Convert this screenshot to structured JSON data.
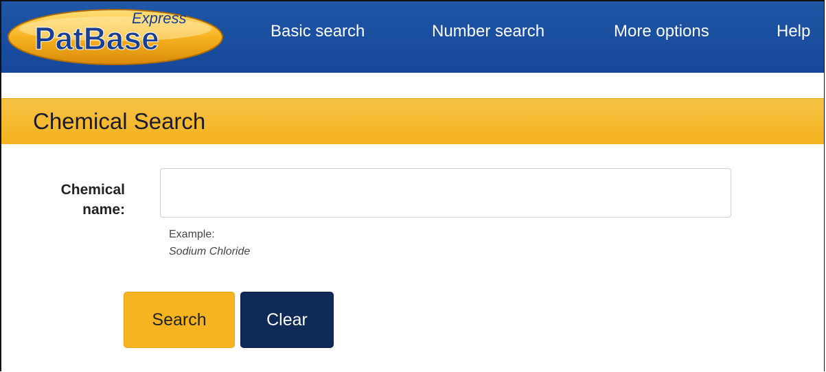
{
  "logo": {
    "name": "PatBase",
    "tagline": "Express"
  },
  "nav": {
    "items": [
      "Basic search",
      "Number search",
      "More options",
      "Help"
    ]
  },
  "page": {
    "title": "Chemical Search"
  },
  "form": {
    "field_label": "Chemical\nname:",
    "input_value": "",
    "input_placeholder": "",
    "example_label": "Example:",
    "example_value": "Sodium Chloride"
  },
  "buttons": {
    "search_label": "Search",
    "clear_label": "Clear"
  },
  "colors": {
    "navbar": "#1a4f9f",
    "header_bar": "#f5b829",
    "search_button": "#f7b421",
    "clear_button": "#0f2a56"
  }
}
